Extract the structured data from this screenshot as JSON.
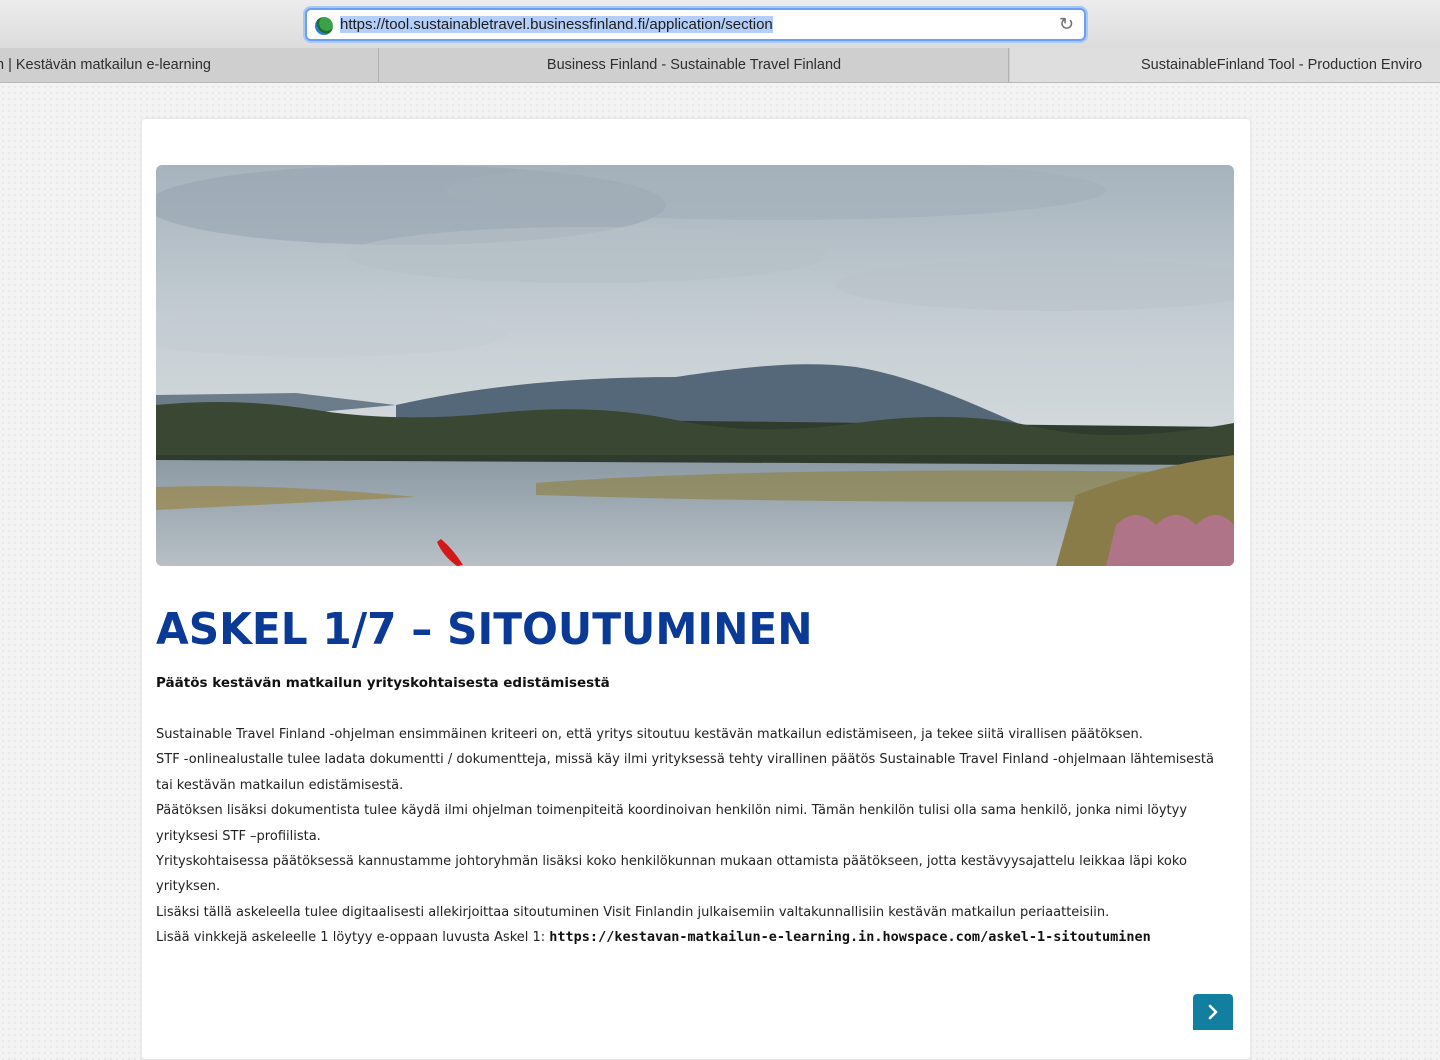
{
  "browser": {
    "url_selected": "https://tool.sustainabletravel.businessfinland.fi/application/section",
    "reload_icon": "reload-icon",
    "tabs": [
      {
        "label": "n | Kestävän matkailun e-learning"
      },
      {
        "label": "Business Finland - Sustainable Travel Finland"
      },
      {
        "label": "SustainableFinland Tool - Production Enviro"
      }
    ]
  },
  "page": {
    "title": "ASKEL 1/7 – SITOUTUMINEN",
    "subtitle": "Päätös kestävän matkailun yrityskohtaisesta edistämisestä",
    "paragraphs": [
      "Sustainable Travel Finland -ohjelman ensimmäinen kriteeri on, että yritys sitoutuu kestävän matkailun edistämiseen, ja tekee siitä virallisen päätöksen.",
      "STF -onlinealustalle tulee ladata dokumentti / dokumentteja, missä käy ilmi yrityksessä tehty virallinen päätös Sustainable Travel Finland -ohjelmaan lähtemisestä tai kestävän matkailun edistämisestä.",
      "Päätöksen lisäksi dokumentista tulee käydä ilmi ohjelman toimenpiteitä koordinoivan henkilön nimi. Tämän henkilön tulisi olla sama henkilö, jonka nimi löytyy yrityksesi STF –profiilista.",
      "Yrityskohtaisessa päätöksessä kannustamme johtoryhmän lisäksi koko henkilökunnan mukaan ottamista päätökseen, jotta kestävyysajattelu leikkaa läpi koko yrityksen.",
      "Lisäksi tällä askeleella tulee digitaalisesti allekirjoittaa sitoutuminen Visit Finlandin julkaisemiin valtakunnallisiin kestävän matkailun periaatteisiin."
    ],
    "link_prefix": "Lisää vinkkejä askeleelle 1 löytyy e-oppaan luvusta Askel 1: ",
    "link_text": "https://kestavan-matkailun-e-learning.in.howspace.com/askel-1-sitoutuminen",
    "hero_image": "lake-landscape-with-fell",
    "next_icon": "chevron-right-icon"
  },
  "colors": {
    "title": "#0a3a96",
    "next_button": "#127fa0",
    "url_highlight": "#b3cef8"
  }
}
